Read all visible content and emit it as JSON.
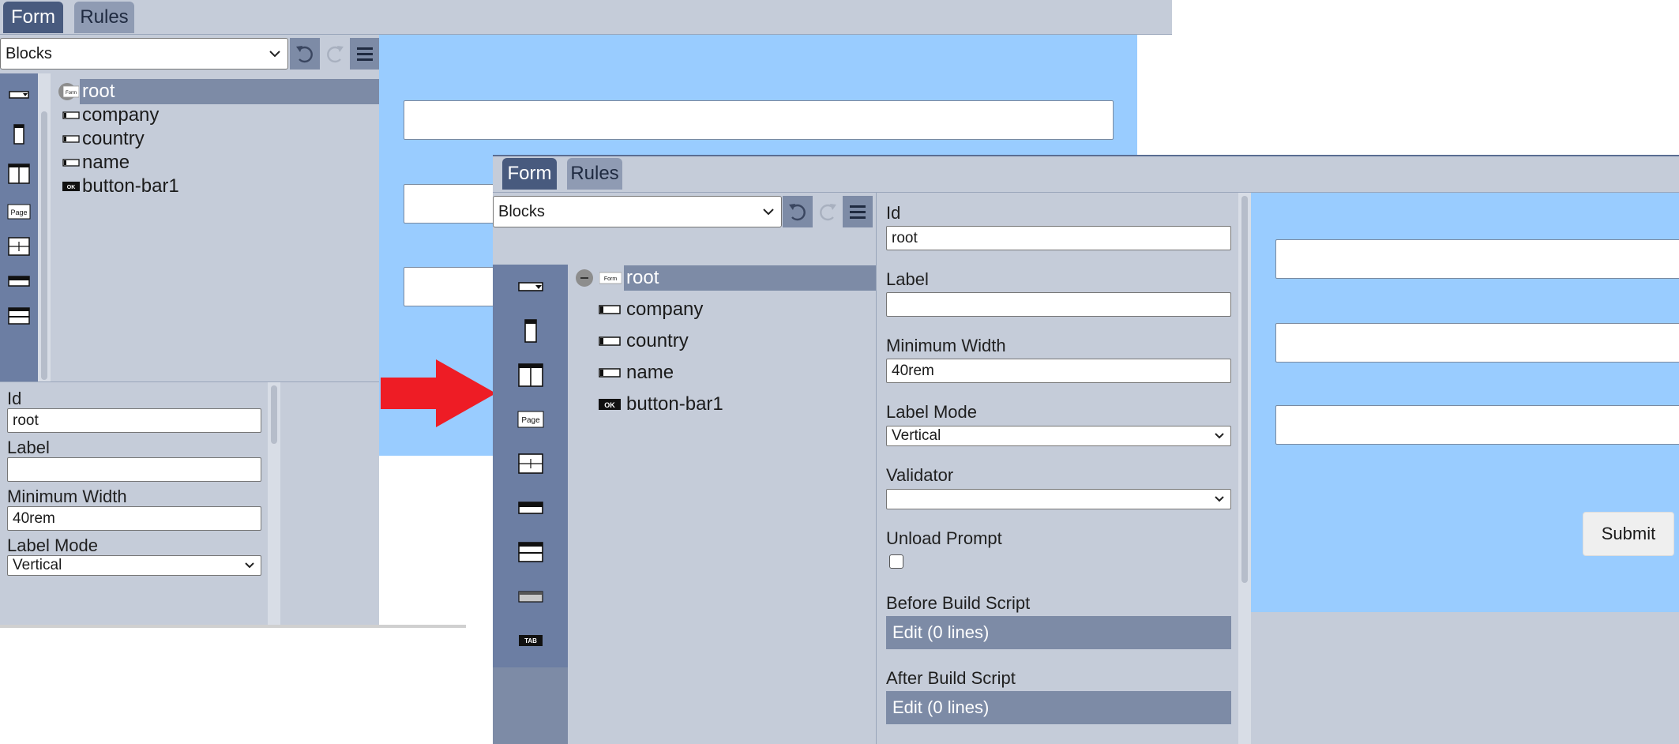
{
  "tabs": [
    {
      "label": "Form",
      "active": true
    },
    {
      "label": "Rules",
      "active": false
    }
  ],
  "toolbar": {
    "blocks_select": "Blocks",
    "icons": [
      "undo-icon",
      "redo-icon",
      "menu-icon"
    ]
  },
  "palette": {
    "icons": [
      "field-block-icon",
      "vertical-block-icon",
      "columns-block-icon",
      "page-block-icon",
      "grid-block-icon",
      "header-block-icon",
      "section-block-icon",
      "panel-block-icon",
      "tab-block-icon"
    ],
    "page_text": "Page",
    "tab_text": "TAB"
  },
  "tree": {
    "root": {
      "label": "root",
      "icon_text": "Form"
    },
    "items": [
      {
        "label": "company",
        "icon": "field-icon"
      },
      {
        "label": "country",
        "icon": "field-icon"
      },
      {
        "label": "name",
        "icon": "field-icon"
      },
      {
        "label": "button-bar1",
        "icon": "button-bar-icon",
        "icon_text": "OK"
      }
    ]
  },
  "properties": {
    "id": {
      "label": "Id",
      "value": "root"
    },
    "label": {
      "label": "Label",
      "value": ""
    },
    "min_width": {
      "label": "Minimum Width",
      "value": "40rem"
    },
    "label_mode": {
      "label": "Label Mode",
      "value": "Vertical"
    },
    "validator": {
      "label": "Validator",
      "value": ""
    },
    "unload_prompt": {
      "label": "Unload Prompt",
      "checked": false
    },
    "before_build_script": {
      "label": "Before Build Script",
      "button": "Edit (0 lines)"
    },
    "after_build_script": {
      "label": "After Build Script",
      "button": "Edit (0 lines)"
    }
  },
  "preview": {
    "submit_label": "Submit"
  },
  "colors": {
    "tab_active": "#485a7e",
    "tab_inactive": "#8f9bb3",
    "builder_bg": "#c5ccd9",
    "palette_bg": "#6c7ea3",
    "selection": "#7d8ba6",
    "preview_bg": "#99ccff",
    "arrow": "#ee1c25"
  }
}
